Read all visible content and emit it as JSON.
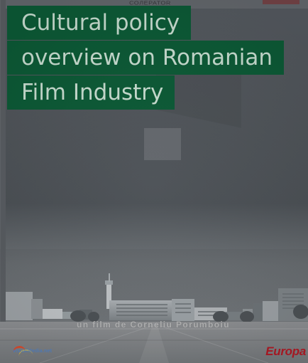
{
  "header": {
    "top_text": "СОЛЕРАТОR",
    "title_lines": [
      "Cultural policy",
      "overview on Romanian",
      "Film Industry"
    ]
  },
  "poster": {
    "credit": "un film de Corneliu Porumboiu",
    "left_logo": "visualMedia.net",
    "brand": "Europa"
  },
  "colors": {
    "title_bg": "#0c5a36",
    "title_text": "#c8ddd0",
    "poster_bg": "#4f5459",
    "brand_red": "#b21924"
  }
}
